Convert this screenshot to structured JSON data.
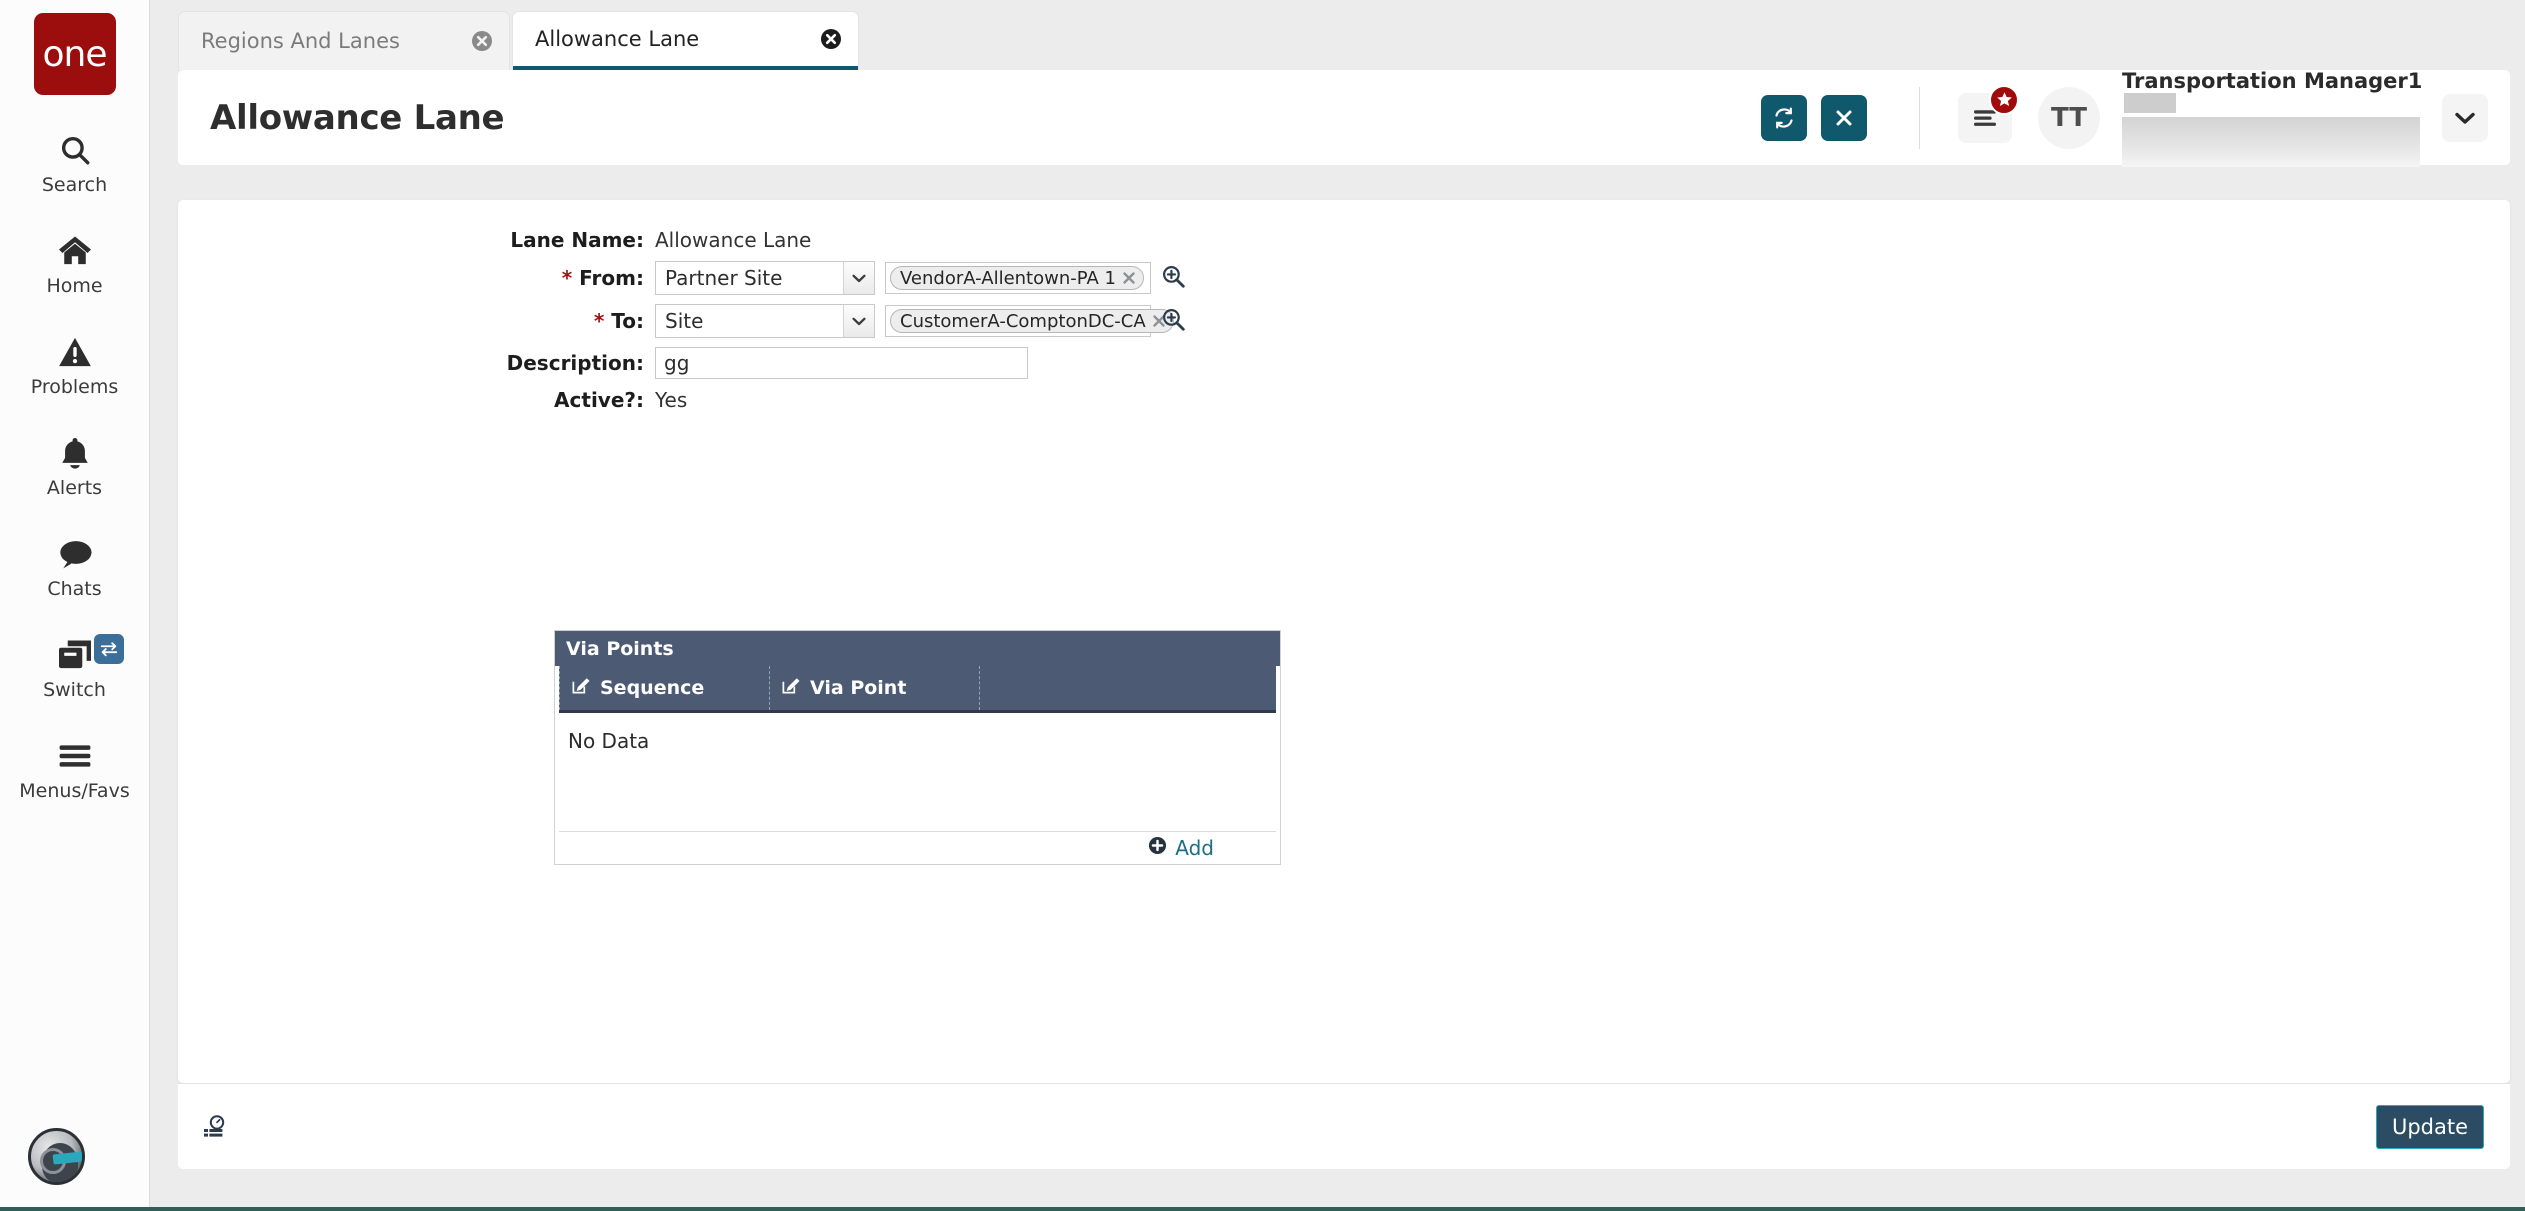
{
  "brand": {
    "logo_text": "one",
    "logo_color": "#9c0d0d"
  },
  "sidebar": {
    "items": [
      {
        "label": "Search",
        "icon": "search-icon"
      },
      {
        "label": "Home",
        "icon": "home-icon"
      },
      {
        "label": "Problems",
        "icon": "warning-triangle-icon"
      },
      {
        "label": "Alerts",
        "icon": "bell-icon"
      },
      {
        "label": "Chats",
        "icon": "chat-bubble-icon"
      },
      {
        "label": "Switch",
        "icon": "windows-stack-icon",
        "badge_icon": "swap-arrows-icon"
      },
      {
        "label": "Menus/Favs",
        "icon": "hamburger-icon"
      }
    ],
    "assistant_avatar": "ai-assistant-avatar"
  },
  "tabs": [
    {
      "label": "Regions And Lanes",
      "active": false,
      "close_icon": "close-circle-icon"
    },
    {
      "label": "Allowance Lane",
      "active": true,
      "close_icon": "close-circle-icon"
    }
  ],
  "header": {
    "title": "Allowance Lane",
    "actions": [
      {
        "name": "refresh-button",
        "icon": "refresh-icon",
        "color": "#10596c"
      },
      {
        "name": "close-button",
        "icon": "x-icon",
        "color": "#10596c"
      }
    ],
    "menus_favs": {
      "icon": "hamburger-icon",
      "badge_icon": "star-icon",
      "badge_color": "#a00a0a"
    },
    "user": {
      "initials": "TT",
      "name": "Transportation Manager1",
      "caret_icon": "chevron-down-icon"
    }
  },
  "form": {
    "lane_name": {
      "label": "Lane Name:",
      "value": "Allowance Lane"
    },
    "from": {
      "label": "From:",
      "required": true,
      "select_value": "Partner Site",
      "chip": "VendorA-Allentown-PA 1",
      "chip_remove_icon": "x-icon",
      "lookup_icon": "magnifier-plus-icon"
    },
    "to": {
      "label": "To:",
      "required": true,
      "select_value": "Site",
      "chip": "CustomerA-ComptonDC-CA",
      "chip_remove_icon": "x-icon",
      "lookup_icon": "magnifier-plus-icon"
    },
    "description": {
      "label": "Description:",
      "value": "gg",
      "placeholder": ""
    },
    "active": {
      "label": "Active?:",
      "value": "Yes"
    }
  },
  "via_points": {
    "panel_title": "Via Points",
    "columns": [
      {
        "label": "Sequence",
        "icon": "edit-pencil-icon"
      },
      {
        "label": "Via Point",
        "icon": "edit-pencil-icon"
      }
    ],
    "rows": [],
    "empty_text": "No Data",
    "add_label": "Add",
    "add_icon": "plus-circle-icon",
    "header_color": "#4c5b73"
  },
  "footer": {
    "info_icon": "gauge-list-icon",
    "update_label": "Update",
    "update_color": "#2b4c63"
  }
}
